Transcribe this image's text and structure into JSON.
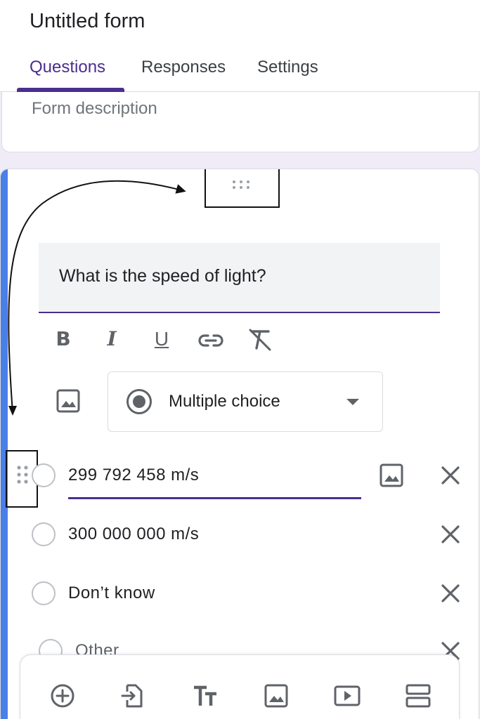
{
  "header": {
    "title": "Untitled form",
    "tabs": [
      {
        "label": "Questions",
        "active": true
      },
      {
        "label": "Responses",
        "active": false
      },
      {
        "label": "Settings",
        "active": false
      }
    ]
  },
  "description": {
    "placeholder": "Form description"
  },
  "question": {
    "text": "What is the speed of light?",
    "type": "Multiple choice",
    "format_icons": [
      "bold-icon",
      "italic-icon",
      "underline-icon",
      "link-icon",
      "clear-format-icon"
    ],
    "options": [
      {
        "label": "299 792 458 m/s"
      },
      {
        "label": "300 000 000 m/s"
      },
      {
        "label": "Don’t know"
      },
      {
        "label": "Other"
      }
    ]
  },
  "toolbar": {
    "icons": [
      "add-question-icon",
      "import-questions-icon",
      "add-title-icon",
      "add-image-icon",
      "add-video-icon",
      "add-section-icon"
    ]
  },
  "colors": {
    "accent": "#4a2f8e",
    "card_accent": "#4a7fe8",
    "background": "#efebf7"
  }
}
